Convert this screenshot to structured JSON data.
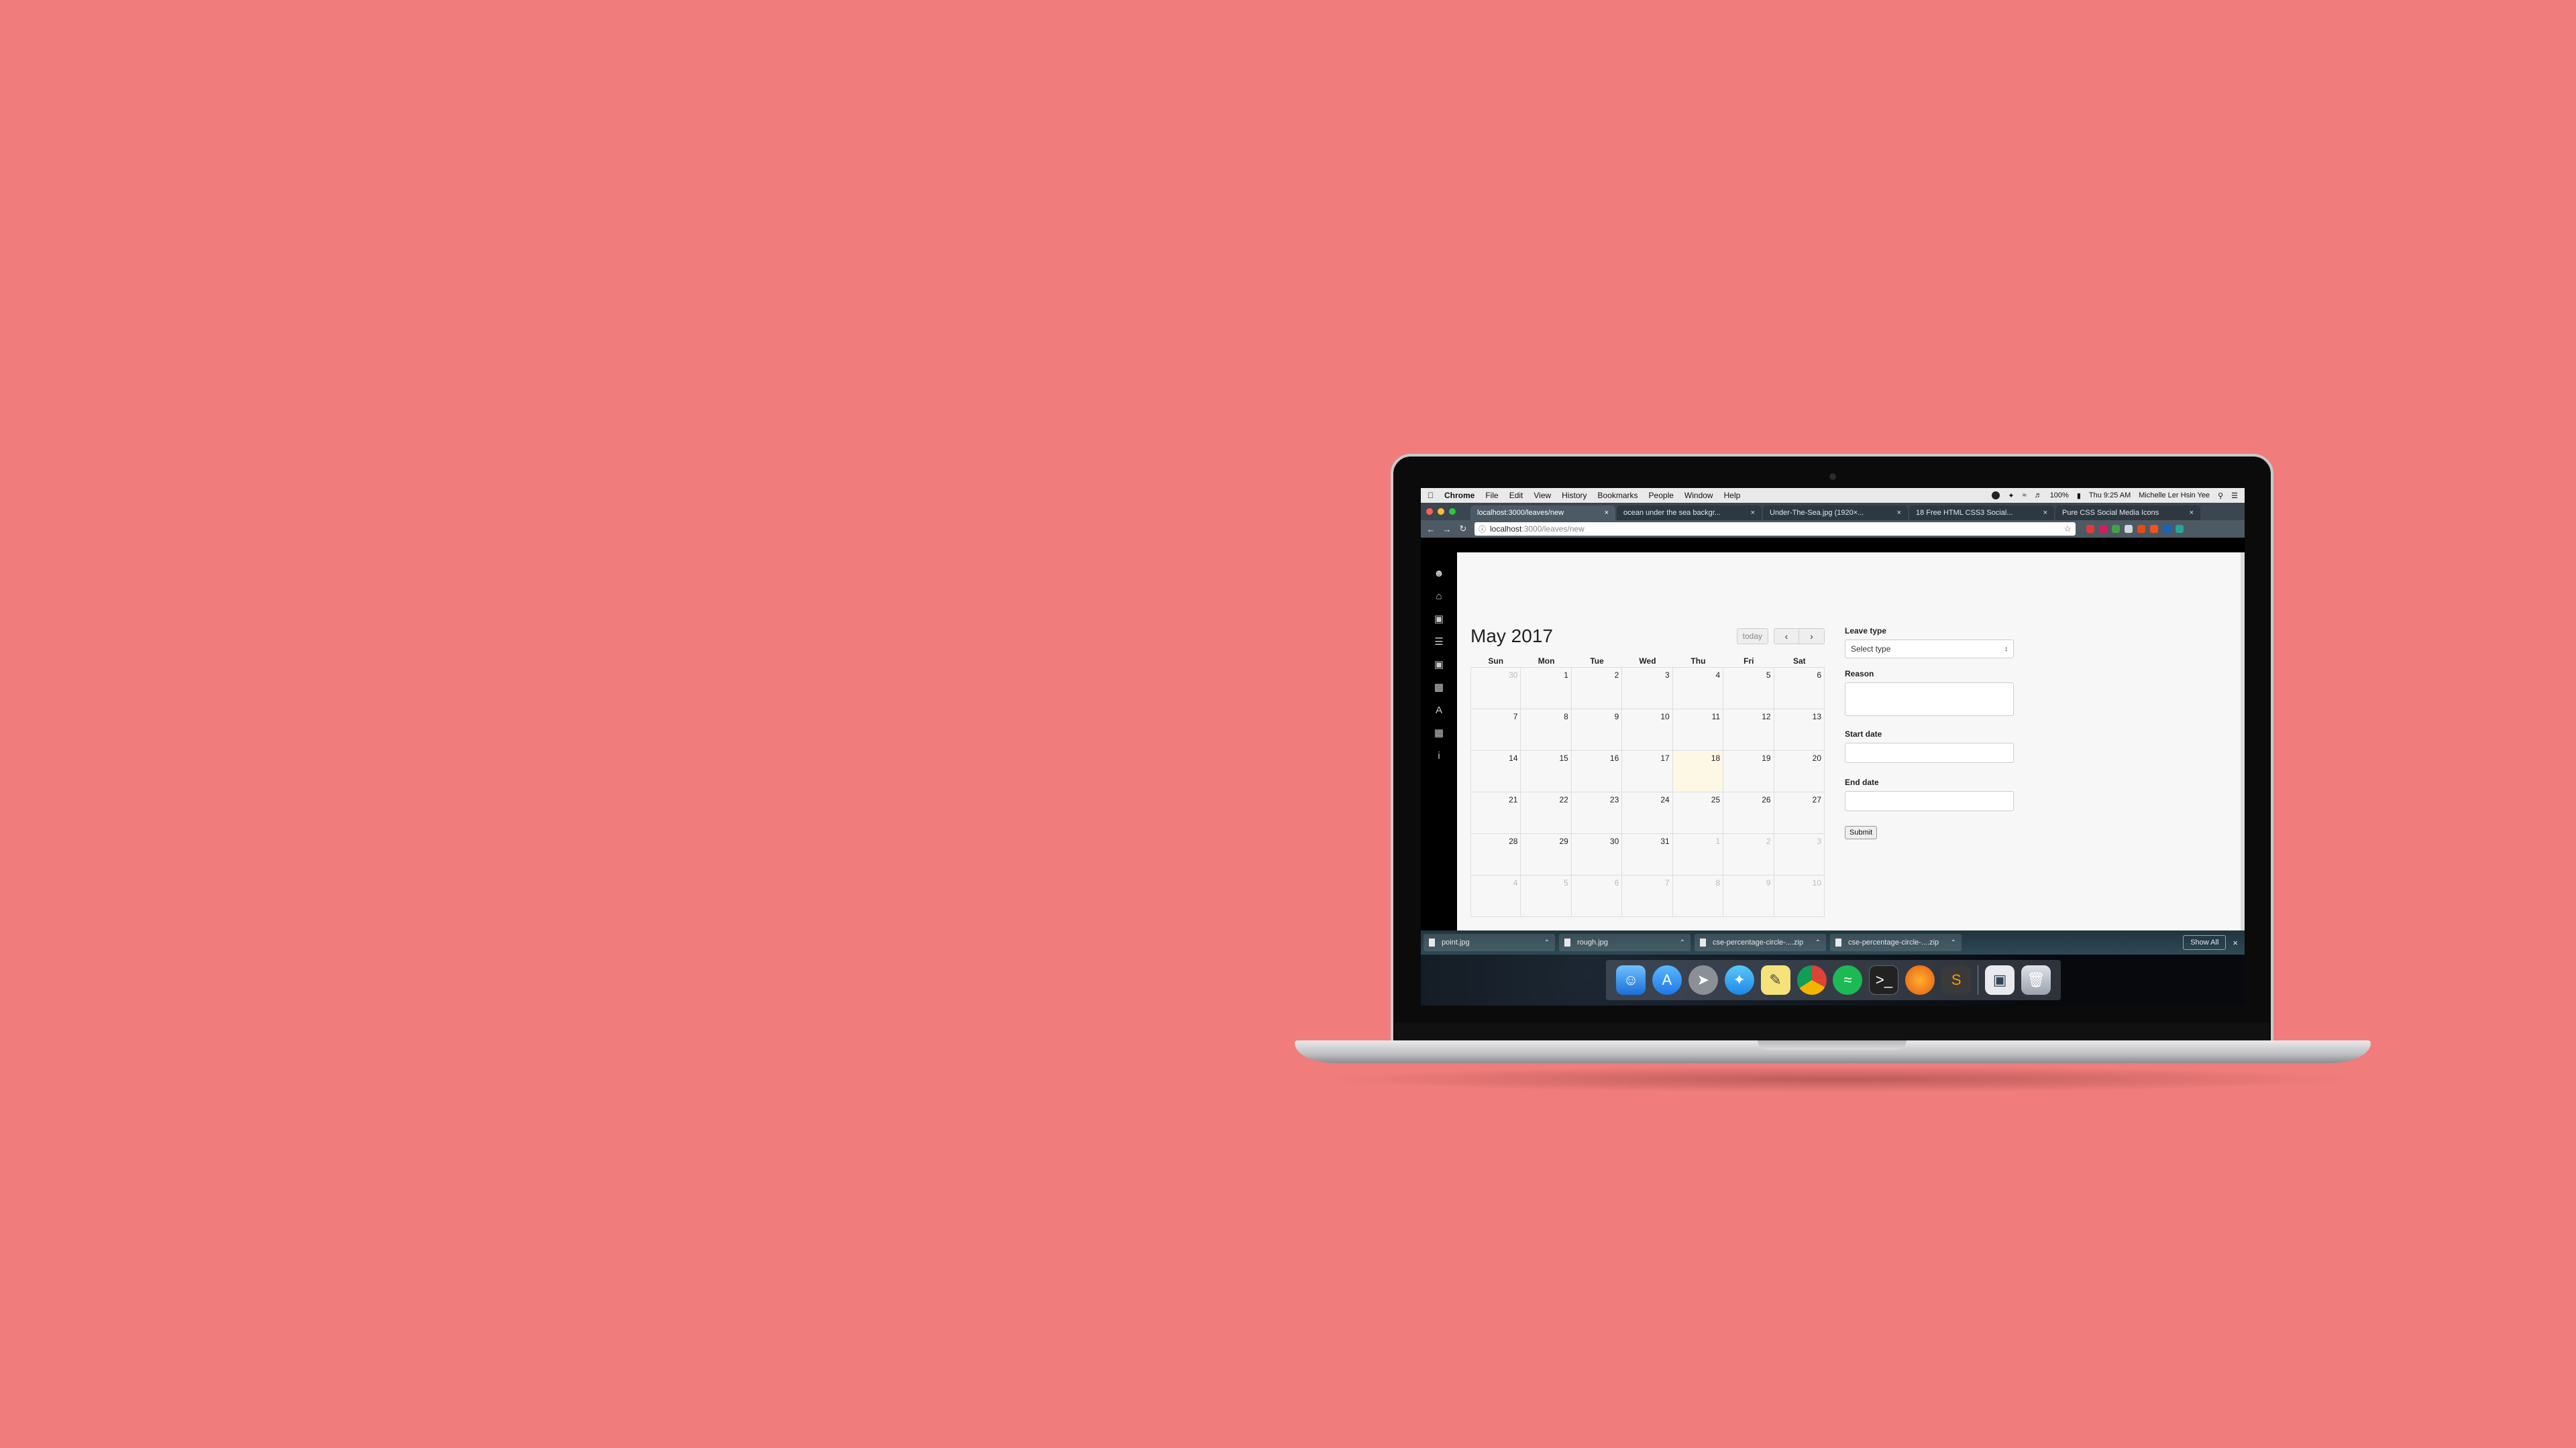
{
  "menubar": {
    "apple": "",
    "items": [
      "Chrome",
      "File",
      "Edit",
      "View",
      "History",
      "Bookmarks",
      "People",
      "Window",
      "Help"
    ],
    "battery": "100%",
    "clock": "Thu 9:25 AM",
    "user": "Michelle Ler Hsin Yee"
  },
  "tabs": [
    {
      "label": "localhost:3000/leaves/new"
    },
    {
      "label": "ocean under the sea backgr..."
    },
    {
      "label": "Under-The-Sea.jpg (1920×..."
    },
    {
      "label": "18 Free HTML CSS3 Social..."
    },
    {
      "label": "Pure CSS Social Media Icons"
    }
  ],
  "omnibox": {
    "host": "localhost",
    "path": ":3000/leaves/new"
  },
  "calendar": {
    "title": "May 2017",
    "today_label": "today",
    "prev": "‹",
    "next": "›",
    "dow": [
      "Sun",
      "Mon",
      "Tue",
      "Wed",
      "Thu",
      "Fri",
      "Sat"
    ],
    "days": [
      {
        "d": "30",
        "other": true
      },
      {
        "d": "1"
      },
      {
        "d": "2"
      },
      {
        "d": "3"
      },
      {
        "d": "4"
      },
      {
        "d": "5"
      },
      {
        "d": "6"
      },
      {
        "d": "7"
      },
      {
        "d": "8"
      },
      {
        "d": "9"
      },
      {
        "d": "10"
      },
      {
        "d": "11"
      },
      {
        "d": "12"
      },
      {
        "d": "13"
      },
      {
        "d": "14"
      },
      {
        "d": "15"
      },
      {
        "d": "16"
      },
      {
        "d": "17"
      },
      {
        "d": "18",
        "today": true
      },
      {
        "d": "19"
      },
      {
        "d": "20"
      },
      {
        "d": "21"
      },
      {
        "d": "22"
      },
      {
        "d": "23"
      },
      {
        "d": "24"
      },
      {
        "d": "25"
      },
      {
        "d": "26"
      },
      {
        "d": "27"
      },
      {
        "d": "28"
      },
      {
        "d": "29"
      },
      {
        "d": "30"
      },
      {
        "d": "31"
      },
      {
        "d": "1",
        "other": true
      },
      {
        "d": "2",
        "other": true
      },
      {
        "d": "3",
        "other": true
      },
      {
        "d": "4",
        "other": true
      },
      {
        "d": "5",
        "other": true
      },
      {
        "d": "6",
        "other": true
      },
      {
        "d": "7",
        "other": true
      },
      {
        "d": "8",
        "other": true
      },
      {
        "d": "9",
        "other": true
      },
      {
        "d": "10",
        "other": true
      }
    ]
  },
  "form": {
    "leave_type_label": "Leave type",
    "leave_type_value": "Select type",
    "reason_label": "Reason",
    "start_label": "Start date",
    "end_label": "End date",
    "submit": "Submit"
  },
  "downloads": [
    {
      "label": "point.jpg"
    },
    {
      "label": "rough.jpg"
    },
    {
      "label": "cse-percentage-circle-....zip"
    },
    {
      "label": "cse-percentage-circle-....zip"
    }
  ],
  "downloads_show_all": "Show All",
  "sidebar_icons": [
    "user-icon",
    "home-icon",
    "laptop-icon",
    "list-icon",
    "folder-icon",
    "bar-chart-icon",
    "font-icon",
    "table-icon",
    "info-icon"
  ],
  "dock_icons": [
    "finder-icon",
    "app-store-icon",
    "launchpad-icon",
    "safari-icon",
    "notes-icon",
    "chrome-icon",
    "spotify-icon",
    "terminal-icon",
    "firefox-icon",
    "sublime-icon",
    "preview-icon",
    "trash-icon"
  ],
  "colors": {
    "background": "#f07d7b",
    "today": "#fcf8e3",
    "chrome_tab_bar": "#3b4650"
  }
}
